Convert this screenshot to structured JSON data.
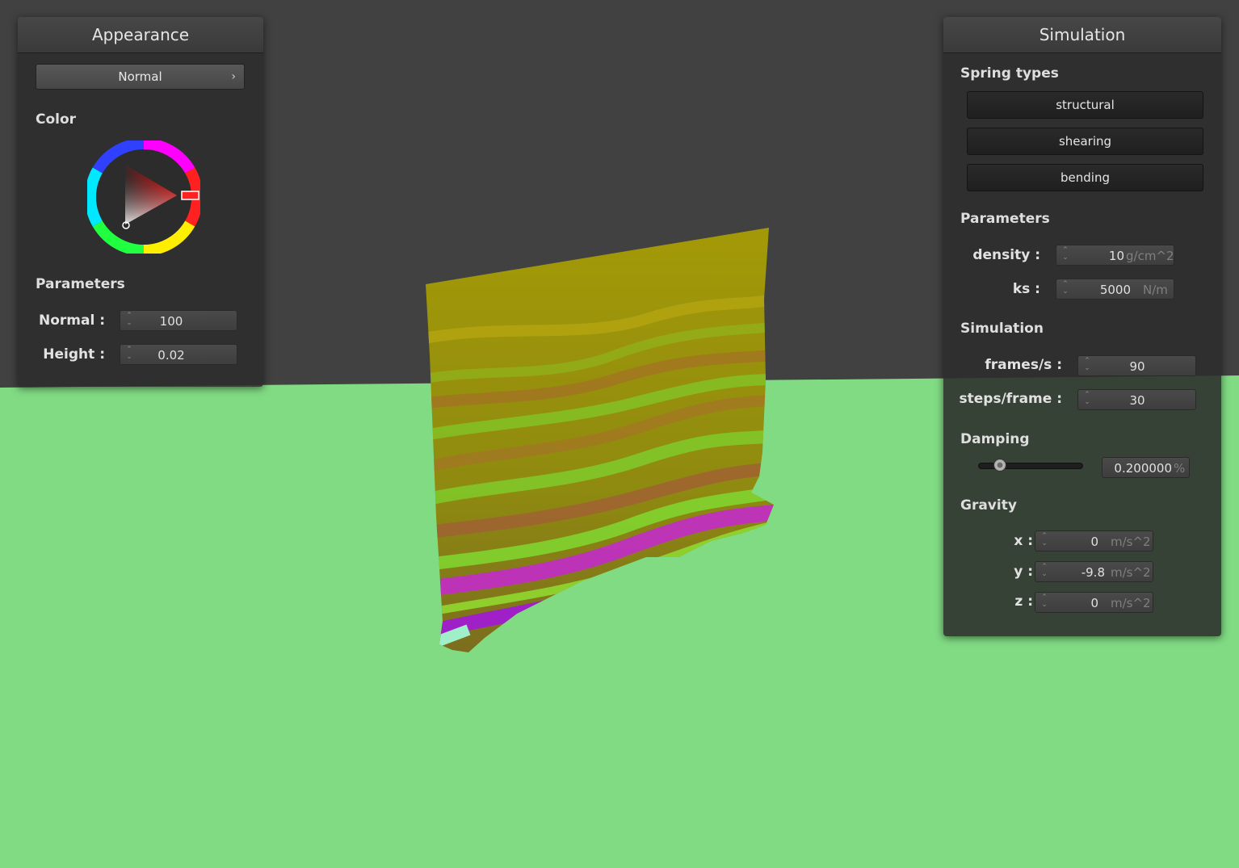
{
  "appearance": {
    "title": "Appearance",
    "shader_selected": "Normal",
    "color_label": "Color",
    "color_value": "#ff0000",
    "parameters_label": "Parameters",
    "normal_label": "Normal :",
    "normal_value": "100",
    "height_label": "Height :",
    "height_value": "0.02"
  },
  "simulation": {
    "title": "Simulation",
    "spring_types_label": "Spring types",
    "springs": [
      "structural",
      "shearing",
      "bending"
    ],
    "parameters_label": "Parameters",
    "density_label": "density :",
    "density_value": "10",
    "density_unit": "g/cm^2",
    "ks_label": "ks :",
    "ks_value": "5000",
    "ks_unit": "N/m",
    "simulation_label": "Simulation",
    "fps_label": "frames/s :",
    "fps_value": "90",
    "steps_label": "steps/frame :",
    "steps_value": "30",
    "damping_label": "Damping",
    "damping_fraction": 0.2,
    "damping_value": "0.200000",
    "damping_unit": "%",
    "gravity_label": "Gravity",
    "gx_label": "x :",
    "gx_value": "0",
    "gy_label": "y :",
    "gy_value": "-9.8",
    "gz_label": "z :",
    "gz_value": "0",
    "gravity_unit": "m/s^2"
  },
  "scene": {
    "background_color": "#414141",
    "floor_color": "#80db83"
  }
}
